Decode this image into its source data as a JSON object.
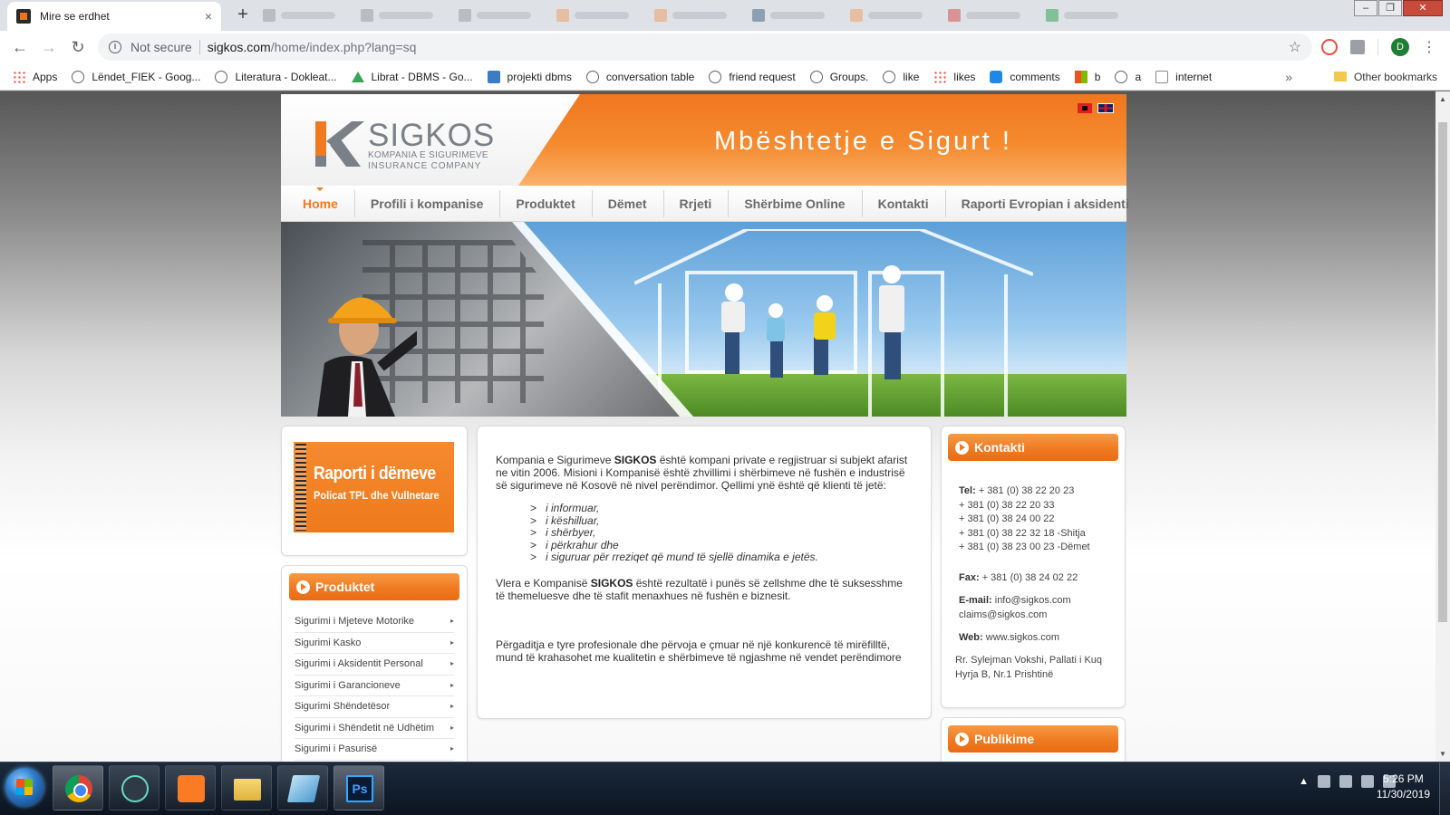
{
  "browser": {
    "tab_title": "Mire se erdhet",
    "new_tab_symbol": "+",
    "close_tab_symbol": "×",
    "not_secure": "Not secure",
    "url_host": "sigkos.com",
    "url_path": "/home/index.php?lang=sq",
    "profile_initial": "D",
    "bookmarks": [
      {
        "label": "Apps",
        "icon": "apps-grid-icon"
      },
      {
        "label": "Lëndet_FIEK - Goog...",
        "icon": "globe-icon"
      },
      {
        "label": "Literatura - Dokleat...",
        "icon": "globe-icon"
      },
      {
        "label": "Librat - DBMS - Go...",
        "icon": "drive-icon"
      },
      {
        "label": "projekti dbms",
        "icon": "bookmark-icon"
      },
      {
        "label": "conversation table",
        "icon": "page-icon"
      },
      {
        "label": "friend request",
        "icon": "page-icon"
      },
      {
        "label": "Groups.",
        "icon": "page-icon"
      },
      {
        "label": "like",
        "icon": "page-icon"
      },
      {
        "label": "likes",
        "icon": "apps-grid-icon"
      },
      {
        "label": "comments",
        "icon": "can-icon"
      },
      {
        "label": "b",
        "icon": "windows-icon"
      },
      {
        "label": "a",
        "icon": "globe-icon"
      },
      {
        "label": "internet",
        "icon": "ost-icon"
      }
    ],
    "other_bookmarks": "Other bookmarks"
  },
  "site": {
    "logo_name": "SIGKOS",
    "logo_sub1": "KOMPANIA E SIGURIMEVE",
    "logo_sub2": "INSURANCE COMPANY",
    "slogan": "Mbështetje e Sigurt !",
    "nav": [
      "Home",
      "Profili i kompanise",
      "Produktet",
      "Dëmet",
      "Rrjeti",
      "Shërbime Online",
      "Kontakti",
      "Raporti Evropian i aksidenti"
    ],
    "active_nav": "Home",
    "report_title": "Raporti i dëmeve",
    "report_sub": "Policat TPL dhe Vullnetare",
    "products_heading": "Produktet",
    "products": [
      "Sigurimi i Mjeteve Motorike",
      "Sigurimi Kasko",
      "Sigurimi i Aksidentit Personal",
      "Sigurimi i Garancioneve",
      "Sigurimi Shëndetësor",
      "Sigurimi i Shëndetit në Udhëtim",
      "Sigurimi i Pasurisë"
    ],
    "intro_a": "Kompania e  Sigurimeve ",
    "intro_brand": "SIGKOS",
    "intro_b": " është kompani private e regjistruar si subjekt afarist ne vitin 2006.  Misioni i Kompanisë është zhvillimi i shërbimeve në fushën e industrisë së sigurimeve në Kosovë në nivel perëndimor. Qellimi ynë është që  klienti të jetë:",
    "bullets": [
      "i informuar,",
      "i këshilluar,",
      "i shërbyer,",
      "i përkrahur dhe",
      "i siguruar për rreziqet që mund të sjellë dinamika e jetës."
    ],
    "value_a": "Vlera e Kompanisë ",
    "value_brand": "SIGKOS",
    "value_b": " është rezultatë i punës së zellshme dhe të suksesshme të themeluesve dhe të stafit menaxhues në fushën e biznesit.",
    "closing": "Përgaditja e tyre profesionale dhe përvoja e çmuar në një konkurencë të mirëfilltë, mund të krahasohet me kualitetin e shërbimeve të ngjashme në vendet perëndimore",
    "contact_heading": "Kontakti",
    "tel_label": "Tel:",
    "phones": [
      "+ 381 (0) 38  22 20 23",
      "+ 381 (0) 38 22 20 33",
      "+ 381 (0) 38 24 00 22",
      "+ 381 (0) 38 22 32 18 -Shitja",
      "+ 381 (0) 38 23 00 23 -Dëmet"
    ],
    "fax_label": "Fax:",
    "fax": "+ 381 (0) 38 24 02 22",
    "email_label": "E-mail:",
    "email1": "info@sigkos.com",
    "email2": "claims@sigkos.com",
    "web_label": "Web:",
    "web": "www.sigkos.com",
    "address1": "Rr. Sylejman Vokshi, Pallati i Kuq",
    "address2": "Hyrja B, Nr.1 Prishtinë",
    "publications_heading": "Publikime"
  },
  "taskbar": {
    "ps_label": "Ps",
    "time": "5:26 PM",
    "date": "11/30/2019"
  },
  "colors": {
    "brand_orange": "#f07a21",
    "nav_text": "#6a6a6a"
  }
}
